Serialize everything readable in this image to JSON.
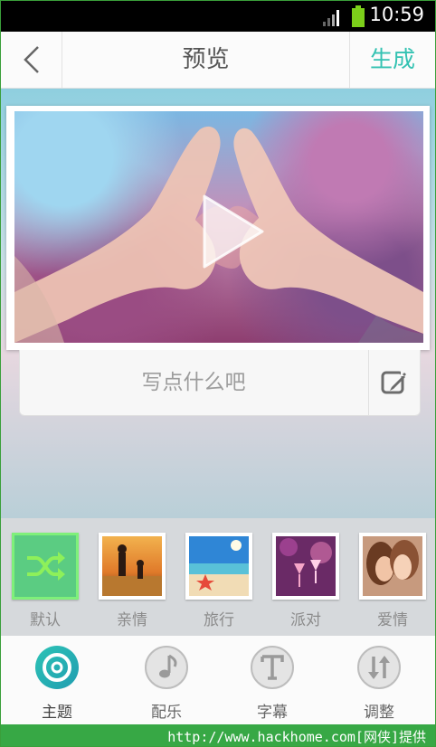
{
  "status_bar": {
    "time": "10:59"
  },
  "header": {
    "title": "预览",
    "generate_label": "生成"
  },
  "caption": {
    "placeholder": "写点什么吧"
  },
  "themes": [
    {
      "label": "默认",
      "selected": true
    },
    {
      "label": "亲情",
      "selected": false
    },
    {
      "label": "旅行",
      "selected": false
    },
    {
      "label": "派对",
      "selected": false
    },
    {
      "label": "爱情",
      "selected": false
    }
  ],
  "tabs": [
    {
      "label": "主题",
      "active": true
    },
    {
      "label": "配乐",
      "active": false
    },
    {
      "label": "字幕",
      "active": false
    },
    {
      "label": "调整",
      "active": false
    }
  ],
  "footer": {
    "watermark": "http://www.hackhome.com[网侠]提供"
  },
  "colors": {
    "accent": "#33c2b2",
    "selected_theme": "#5bcc82",
    "footer_green": "#37a845"
  }
}
